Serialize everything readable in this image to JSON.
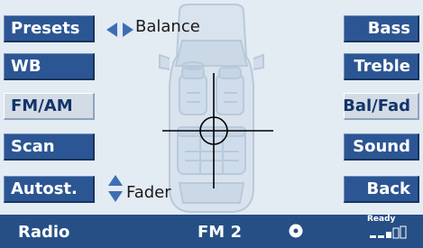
{
  "left_buttons": [
    {
      "label": "Presets",
      "active": false
    },
    {
      "label": "WB",
      "active": false
    },
    {
      "label": "FM/AM",
      "active": true
    },
    {
      "label": "Scan",
      "active": false
    },
    {
      "label": "Autost.",
      "active": false
    }
  ],
  "right_buttons": [
    {
      "label": "Bass"
    },
    {
      "label": "Treble"
    },
    {
      "label": "Bal/Fad",
      "active": true
    },
    {
      "label": "Sound"
    },
    {
      "label": "Back"
    }
  ],
  "balance_label": "Balance",
  "fader_label": "Fader",
  "status": {
    "source": "Radio",
    "band": "FM 2",
    "ready": "Ready"
  },
  "icons": {
    "balance": "left-right-arrow-icon",
    "fader": "up-down-arrow-icon",
    "disc": "disc-icon",
    "signal": "signal-strength-icon"
  },
  "colors": {
    "button": "#2c5693",
    "button_active": "#d3dbe5",
    "background": "#e3ebf3",
    "status_bar": "#264f86",
    "arrow": "#3f6db5"
  }
}
